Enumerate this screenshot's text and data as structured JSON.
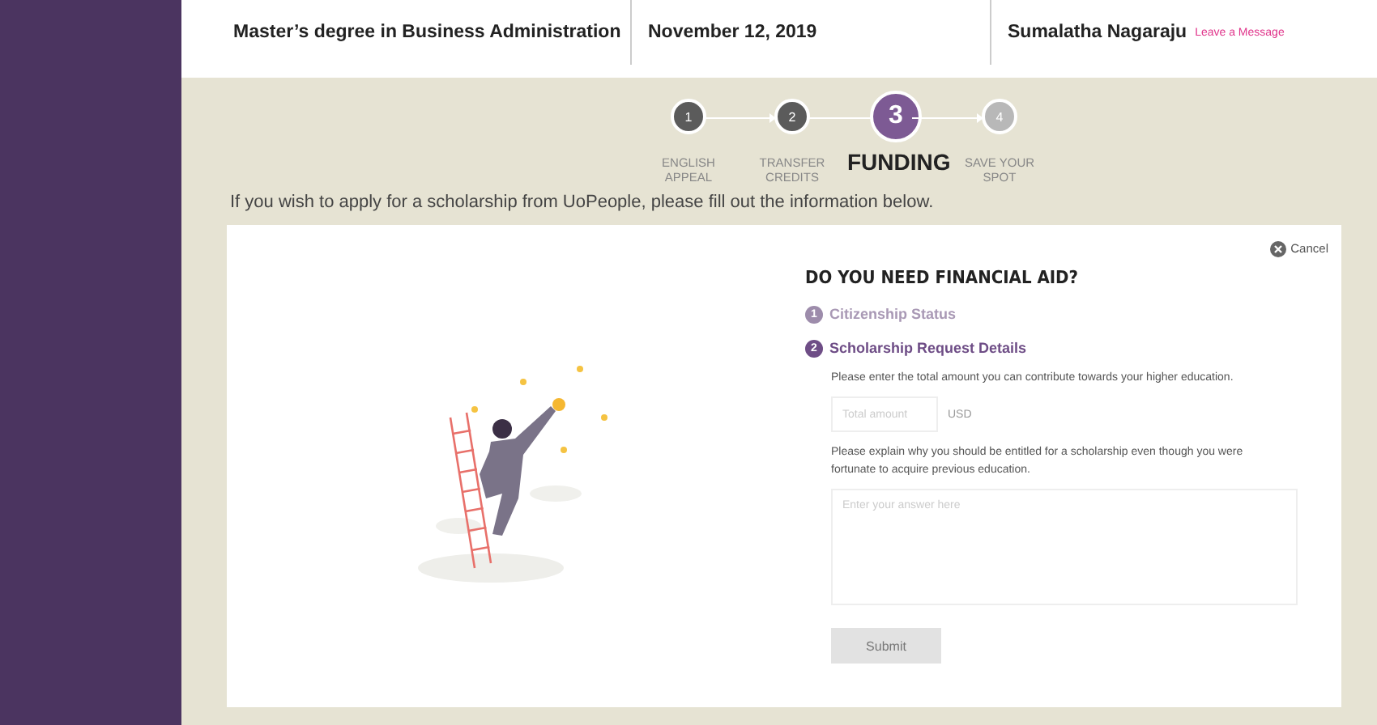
{
  "header": {
    "fields": [
      {
        "value": "Master’s degree in Business Administration"
      },
      {
        "value": "November 12, 2019"
      },
      {
        "value": "Sumalatha Nagaraju",
        "link": "Leave a Message"
      }
    ]
  },
  "steps": [
    {
      "number": "1",
      "label": "ENGLISH APPEAL",
      "done": true,
      "selected": false
    },
    {
      "number": "2",
      "label": "TRANSFER CREDITS",
      "done": true,
      "selected": false
    },
    {
      "number": "3",
      "label": "FUNDING",
      "done": false,
      "selected": true
    },
    {
      "number": "4",
      "label": "SAVE YOUR SPOT",
      "done": false,
      "selected": false
    }
  ],
  "intro": "If you wish to apply for a scholarship from UoPeople, please fill out the information below.",
  "form": {
    "cancel": "Cancel",
    "title": "DO YOU NEED FINANCIAL AID?",
    "sections": [
      {
        "number": "1",
        "title": "Citizenship Status",
        "selected": false
      },
      {
        "number": "2",
        "title": "Scholarship Request Details",
        "selected": true
      }
    ],
    "amount_prompt": "Please enter the total amount you can contribute towards your higher education.",
    "amount": {
      "placeholder": "Total amount",
      "unit": "USD"
    },
    "reason_prompt": "Please explain why you should be entitled for a scholarship even though you were fortunate to acquire previous education.",
    "reason": {
      "placeholder": "Enter your answer here"
    },
    "submit": {
      "label": "Submit",
      "disabled": true
    }
  }
}
